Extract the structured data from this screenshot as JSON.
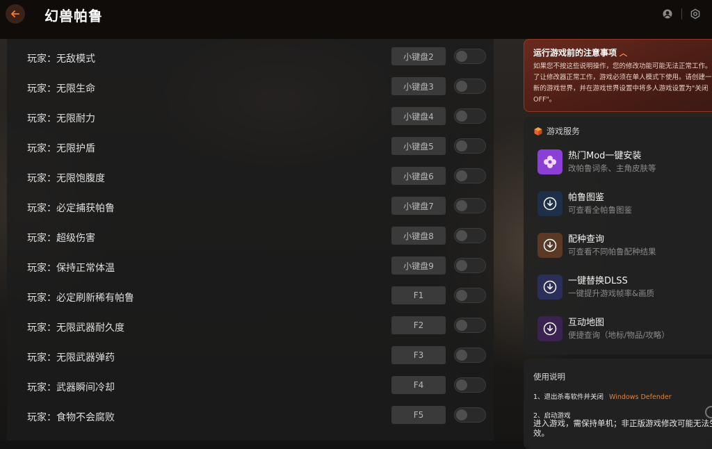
{
  "app": {
    "title": "幻兽帕鲁"
  },
  "titlebar_icons": [
    "back-arrow-icon",
    "user-icon",
    "settings-icon"
  ],
  "cheats": [
    {
      "label": "玩家：无敌模式",
      "key": "小键盘2",
      "enabled": false
    },
    {
      "label": "玩家：无限生命",
      "key": "小键盘3",
      "enabled": false
    },
    {
      "label": "玩家：无限耐力",
      "key": "小键盘4",
      "enabled": false
    },
    {
      "label": "玩家：无限护盾",
      "key": "小键盘5",
      "enabled": false
    },
    {
      "label": "玩家：无限饱腹度",
      "key": "小键盘6",
      "enabled": false
    },
    {
      "label": "玩家：必定捕获帕鲁",
      "key": "小键盘7",
      "enabled": false
    },
    {
      "label": "玩家：超级伤害",
      "key": "小键盘8",
      "enabled": false
    },
    {
      "label": "玩家：保持正常体温",
      "key": "小键盘9",
      "enabled": false
    },
    {
      "label": "玩家：必定刷新稀有帕鲁",
      "key": "F1",
      "enabled": false
    },
    {
      "label": "玩家：无限武器耐久度",
      "key": "F2",
      "enabled": false
    },
    {
      "label": "玩家：无限武器弹药",
      "key": "F3",
      "enabled": false
    },
    {
      "label": "玩家：武器瞬间冷却",
      "key": "F4",
      "enabled": false
    },
    {
      "label": "玩家：食物不会腐败",
      "key": "F5",
      "enabled": false
    }
  ],
  "notice": {
    "title": "运行游戏前的注意事项",
    "text": "如果您不按这些说明操作，您的修改功能可能无法正常工作。为了让修改器正常工作，游戏必须在单人模式下使用。请创建一个新的游戏世界，并在游戏世界设置中将多人游戏设置为\"关闭OFF\"。"
  },
  "services": {
    "title": "游戏服务",
    "items": [
      {
        "title": "热门Mod一键安装",
        "subtitle": "改帕鲁词条、主角皮肤等",
        "icon": "mod-icon",
        "color": "#8b3fd6"
      },
      {
        "title": "帕鲁图鉴",
        "subtitle": "可查看全帕鲁图鉴",
        "icon": "download-icon",
        "color": "#1e2f4a"
      },
      {
        "title": "配种查询",
        "subtitle": "可查看不同帕鲁配种结果",
        "icon": "download-icon",
        "color": "#5a3a26"
      },
      {
        "title": "一键替换DLSS",
        "subtitle": "一键提升游戏帧率&画质",
        "icon": "download-icon",
        "color": "#2a2f5a"
      },
      {
        "title": "互动地图",
        "subtitle": "便捷查询（地标/物品/攻略）",
        "icon": "download-icon",
        "color": "#3a2350"
      }
    ]
  },
  "usage": {
    "title": "使用说明",
    "step1": "1、退出杀毒软件并关闭",
    "step1_highlight": "Windows Defender",
    "step2": "2、启动游戏",
    "step2_text": "进入游戏，需保持单机；非正版游戏修改可能无法生效。"
  }
}
